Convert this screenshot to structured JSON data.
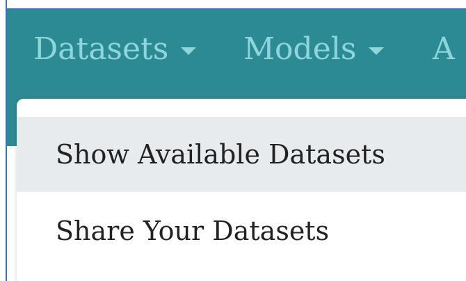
{
  "navbar": {
    "items": [
      {
        "label": "Datasets"
      },
      {
        "label": "Models"
      },
      {
        "label": "A"
      }
    ]
  },
  "dropdown": {
    "items": [
      {
        "label": "Show Available Datasets",
        "state": "hovered"
      },
      {
        "label": "Share Your Datasets"
      }
    ]
  },
  "colors": {
    "navbar_bg": "#2c8a94",
    "nav_text": "#8fd6dc",
    "dropdown_hover_bg": "#e8ebee",
    "dropdown_text": "#222222"
  },
  "icons": {
    "caret": "caret-down-icon"
  }
}
